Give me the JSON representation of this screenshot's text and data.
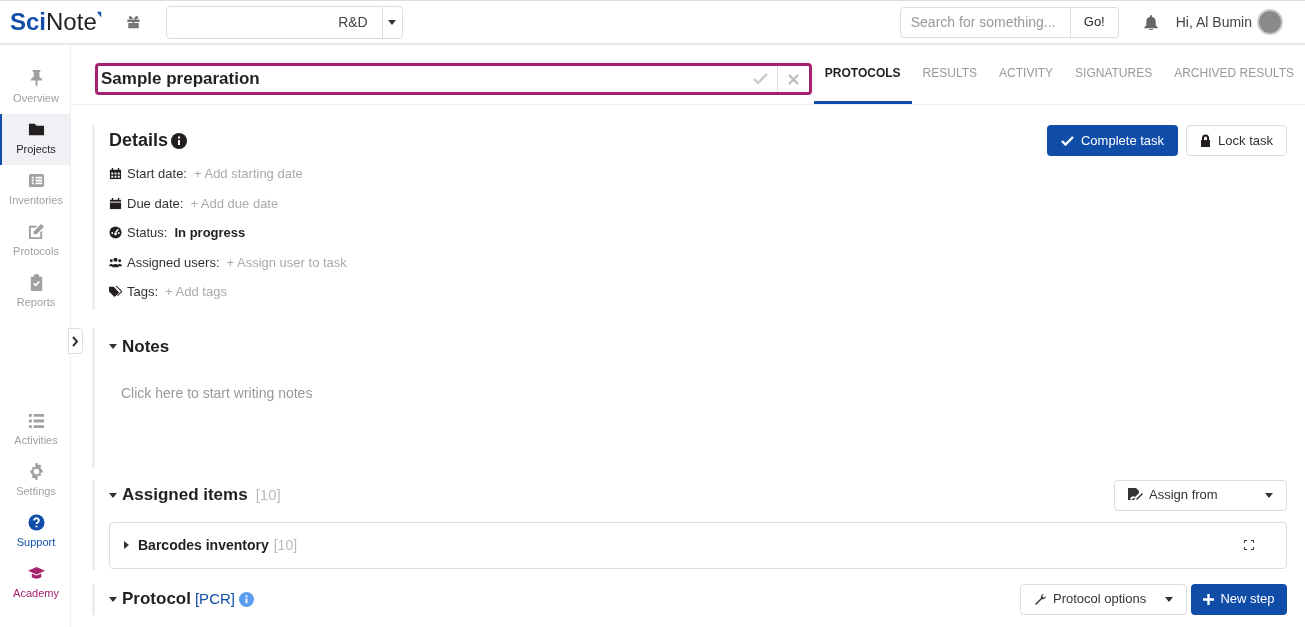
{
  "header": {
    "logo": {
      "part1": "Sci",
      "part2": "Note"
    },
    "team_select": {
      "value": "R&D"
    },
    "search": {
      "placeholder": "Search for something...",
      "button": "Go!"
    },
    "greeting": "Hi, Al Bumin"
  },
  "sidebar": {
    "items": [
      {
        "label": "Overview",
        "selected": false,
        "color": "#a0a0a0"
      },
      {
        "label": "Projects",
        "selected": true,
        "color": "#231f20"
      },
      {
        "label": "Inventories",
        "selected": false,
        "color": "#a0a0a0"
      },
      {
        "label": "Protocols",
        "selected": false,
        "color": "#a0a0a0"
      },
      {
        "label": "Reports",
        "selected": false,
        "color": "#a0a0a0"
      }
    ],
    "bottom_items": [
      {
        "label": "Activities",
        "color": "#a0a0a0"
      },
      {
        "label": "Settings",
        "color": "#a0a0a0"
      },
      {
        "label": "Support",
        "color": "#104da9"
      },
      {
        "label": "Academy",
        "color": "#a7226e"
      }
    ]
  },
  "task_name": {
    "value": "Sample preparation"
  },
  "tabs": [
    {
      "label": "PROTOCOLS",
      "selected": true
    },
    {
      "label": "RESULTS",
      "selected": false
    },
    {
      "label": "ACTIVITY",
      "selected": false
    },
    {
      "label": "SIGNATURES",
      "selected": false
    },
    {
      "label": "ARCHIVED RESULTS",
      "selected": false
    }
  ],
  "details": {
    "title": "Details",
    "buttons": [
      "Complete task",
      "Lock task"
    ],
    "fields": [
      {
        "label": "Start date:",
        "value": "+ Add starting date",
        "kind": "placeholder"
      },
      {
        "label": "Due date:",
        "value": "+ Add due date",
        "kind": "placeholder"
      },
      {
        "label": "Status:",
        "value": "In progress",
        "kind": "value"
      },
      {
        "label": "Assigned users:",
        "value": "+ Assign user to task",
        "kind": "placeholder"
      },
      {
        "label": "Tags:",
        "value": "+ Add tags",
        "kind": "placeholder"
      }
    ]
  },
  "notes": {
    "title": "Notes",
    "expanded": true,
    "placeholder": "Click here to start writing notes"
  },
  "assigned_items": {
    "title": "Assigned items",
    "count": "[10]",
    "expanded": true,
    "button": "Assign from",
    "inventories": [
      {
        "name": "Barcodes inventory",
        "count": "[10]",
        "expanded": false
      }
    ]
  },
  "protocol": {
    "title": "Protocol",
    "name": "[PCR]",
    "expanded": true,
    "buttons": [
      "Protocol options",
      "New step"
    ]
  }
}
